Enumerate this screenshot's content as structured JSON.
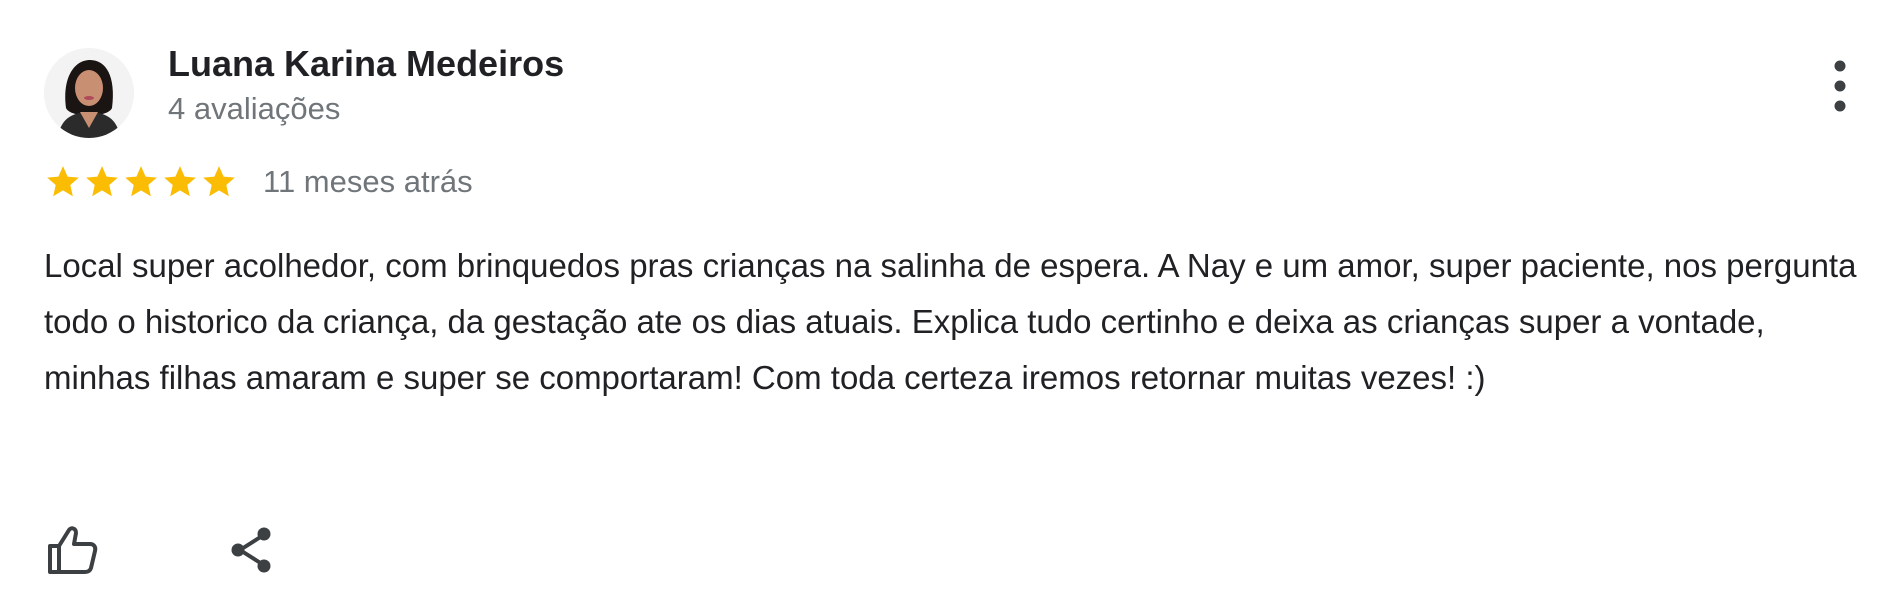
{
  "review": {
    "reviewer_name": "Luana Karina Medeiros",
    "review_count": "4 avaliações",
    "rating": 5,
    "rating_max": 5,
    "date": "11 meses atrás",
    "text": "Local super acolhedor, com brinquedos pras crianças na salinha de espera. A Nay e um amor, super paciente, nos pergunta todo o historico da criança, da gestação ate os dias atuais. Explica tudo certinho e deixa as crianças super a vontade, minhas filhas amaram e super se comportaram! Com toda certeza iremos retornar muitas vezes! :)"
  },
  "icons": {
    "avatar": "avatar-photo",
    "more": "more-vert-icon",
    "star": "star-icon",
    "like": "thumbs-up-icon",
    "share": "share-icon"
  },
  "colors": {
    "star": "#fbbc04",
    "name": "#202124",
    "meta": "#70757a",
    "icon": "#3c4043"
  }
}
